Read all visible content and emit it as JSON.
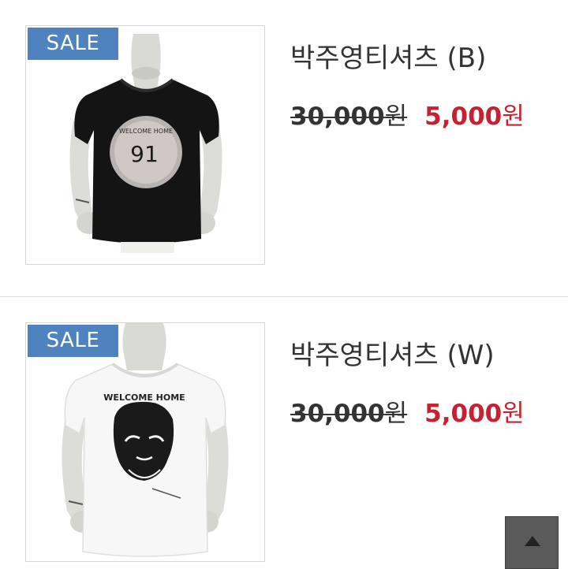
{
  "products": [
    {
      "badge": "SALE",
      "name": "박주영티셔츠 (B)",
      "original_price_value": "30,000",
      "original_price_unit": "원",
      "sale_price_value": "5,000",
      "sale_price_unit": "원",
      "shirt_color": "black",
      "shirt_print": "WELCOME HOME",
      "shirt_number": "91"
    },
    {
      "badge": "SALE",
      "name": "박주영티셔츠 (W)",
      "original_price_value": "30,000",
      "original_price_unit": "원",
      "sale_price_value": "5,000",
      "sale_price_unit": "원",
      "shirt_color": "white",
      "shirt_print": "WELCOME HOME"
    }
  ],
  "colors": {
    "badge_bg": "#4f83bf",
    "sale_price": "#c7202e",
    "scroll_top_button": "#5a5a5a"
  },
  "scroll_top_icon": "triangle-up-icon"
}
